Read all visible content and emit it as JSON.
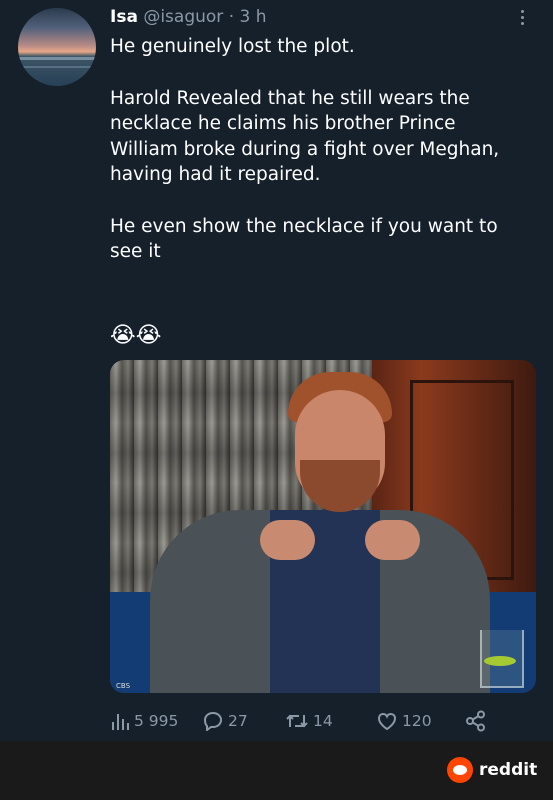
{
  "tweet": {
    "author_name": "Isa",
    "author_handle": "@isaguor",
    "separator": "·",
    "time": "3 h",
    "text_line1": "He genuinely lost the plot.",
    "text_line2": "Harold Revealed that he still wears the",
    "text_line3": "necklace he claims his brother Prince",
    "text_line4": "William broke during a fight over Meghan,",
    "text_line5": "having had it repaired.",
    "text_line6": "He even show the necklace if you want to",
    "text_line7": "see it",
    "emojis": "😭😭",
    "media_watermark": "CBS",
    "stats": {
      "views": "5 995",
      "replies": "27",
      "retweets": "14",
      "likes": "120"
    }
  },
  "footer": {
    "brand": "reddit"
  },
  "icons": {
    "more": "more-options-icon",
    "views": "analytics-icon",
    "reply": "reply-icon",
    "retweet": "retweet-icon",
    "like": "heart-icon",
    "share": "share-icon",
    "brand": "reddit-logo-icon"
  },
  "colors": {
    "background": "#15202b",
    "muted": "#8b98a5",
    "footer_bg": "#1a1a1b",
    "reddit_orange": "#ff4500"
  }
}
